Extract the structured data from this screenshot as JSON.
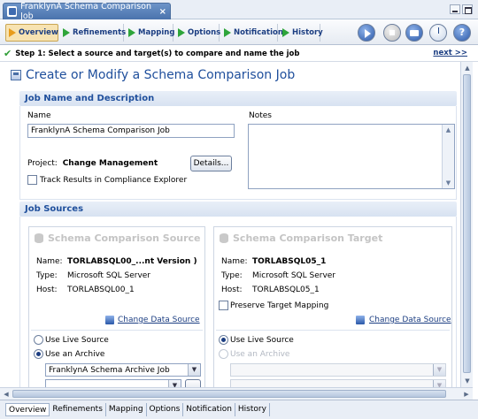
{
  "editor": {
    "title": "FranklynA Schema Comparison Job",
    "close": "×"
  },
  "steps": [
    {
      "label": "Overview",
      "active": true
    },
    {
      "label": "Refinements",
      "active": false
    },
    {
      "label": "Mapping",
      "active": false
    },
    {
      "label": "Options",
      "active": false
    },
    {
      "label": "Notification",
      "active": false
    },
    {
      "label": "History",
      "active": false
    }
  ],
  "toolbar": {
    "help": "?"
  },
  "info": {
    "step_text": "Step 1: Select a source and target(s) to compare and name the job",
    "next": "next >>"
  },
  "page": {
    "title": "Create or Modify a Schema Comparison Job"
  },
  "job_section": {
    "header": "Job Name and Description",
    "name_label": "Name",
    "name_value": "FranklynA Schema Comparison Job",
    "notes_label": "Notes",
    "project_label": "Project:",
    "project_value": "Change Management",
    "details_button": "Details...",
    "track_label": "Track Results in Compliance Explorer"
  },
  "sources_section": {
    "header": "Job Sources",
    "source": {
      "title": "Schema Comparison Source",
      "name_label": "Name:",
      "name_value": "TORLABSQL00_...nt Version )",
      "type_label": "Type:",
      "type_value": "Microsoft SQL Server",
      "host_label": "Host:",
      "host_value": "TORLABSQL00_1",
      "change_link": "Change Data Source",
      "live_label": "Use Live Source",
      "archive_label": "Use an Archive",
      "archive_value": "FranklynA Schema Archive Job"
    },
    "target": {
      "title": "Schema Comparison Target",
      "name_label": "Name:",
      "name_value": "TORLABSQL05_1",
      "type_label": "Type:",
      "type_value": "Microsoft SQL Server",
      "host_label": "Host:",
      "host_value": "TORLABSQL05_1",
      "preserve_label": "Preserve Target Mapping",
      "change_link": "Change Data Source",
      "live_label": "Use Live Source",
      "archive_label": "Use an Archive"
    }
  },
  "bottom_tabs": [
    "Overview",
    "Refinements",
    "Mapping",
    "Options",
    "Notification",
    "History"
  ]
}
